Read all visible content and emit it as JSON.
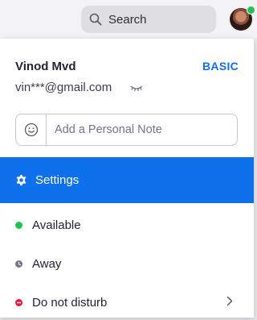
{
  "topbar": {
    "search_label": "Search"
  },
  "profile": {
    "name": "Vinod Mvd",
    "plan": "BASIC",
    "email": "vin***@gmail.com",
    "note_placeholder": "Add a Personal Note"
  },
  "menu": {
    "settings_label": "Settings",
    "statuses": [
      {
        "label": "Available",
        "color": "#23c24f"
      },
      {
        "label": "Away",
        "color": "#747487"
      },
      {
        "label": "Do not disturb",
        "color": "#e8173d"
      }
    ]
  },
  "colors": {
    "accent": "#0e71eb",
    "online": "#23c24f"
  }
}
